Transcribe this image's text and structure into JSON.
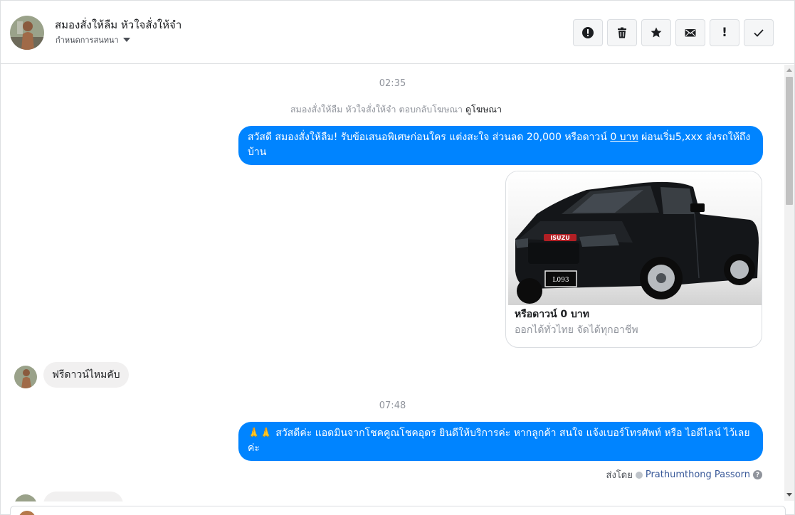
{
  "header": {
    "contact_name": "สมองสั่งให้ลืม หัวใจสั่งให้จำ",
    "subtitle": "กำหนดการสนทนา",
    "actions": [
      {
        "name": "spam-button",
        "icon": "exclamation-circle-icon"
      },
      {
        "name": "delete-button",
        "icon": "trash-icon"
      },
      {
        "name": "star-button",
        "icon": "star-icon"
      },
      {
        "name": "mark-unread-button",
        "icon": "envelope-icon"
      },
      {
        "name": "follow-up-button",
        "icon": "exclamation-icon",
        "glyph": "!"
      },
      {
        "name": "mark-done-button",
        "icon": "checkmark-icon"
      }
    ]
  },
  "conversation": {
    "timestamp_1": "02:35",
    "reply_meta": {
      "text": "สมองสั่งให้ลืม หัวใจสั่งให้จำ ตอบกลับโฆษณา",
      "link": "ดูโฆษณา"
    },
    "outgoing_1": {
      "before": "สวัสดี สมองสั่งให้ลืม! รับข้อเสนอพิเศษก่อนใคร แต่งสะใจ ส่วนลด 20,000 หรือดาวน์ ",
      "underlined": "0 บาท",
      "after": " ผ่อนเริ่ม5,xxx ส่งรถให้ถึงบ้าน"
    },
    "ad_card": {
      "title": "หรือดาวน์ 0 บาท",
      "subtitle": "ออกได้ทั่วไทย จัดได้ทุกอาชีพ",
      "image_brand": "ISUZU",
      "plate": "L093"
    },
    "incoming_1": "ฟรีดาวน์ไหมคับ",
    "timestamp_2": "07:48",
    "outgoing_2": {
      "emoji": "🙏🙏",
      "text": " สวัสดีค่ะ แอดมินจากโชคคูณโชคอุดร ยินดีให้บริการค่ะ หากลูกค้า สนใจ แจ้งเบอร์โทรศัพท์ หรือ ไอดีไลน์ ไว้เลยค่ะ"
    },
    "sent_by_label": "ส่งโดย",
    "sent_by_name": "Prathumthong Passorn",
    "help_glyph": "?"
  },
  "colors": {
    "outgoing_bubble": "#0084ff",
    "incoming_bubble": "#f1f0f0",
    "meta_text": "#90949c",
    "link": "#385898"
  }
}
